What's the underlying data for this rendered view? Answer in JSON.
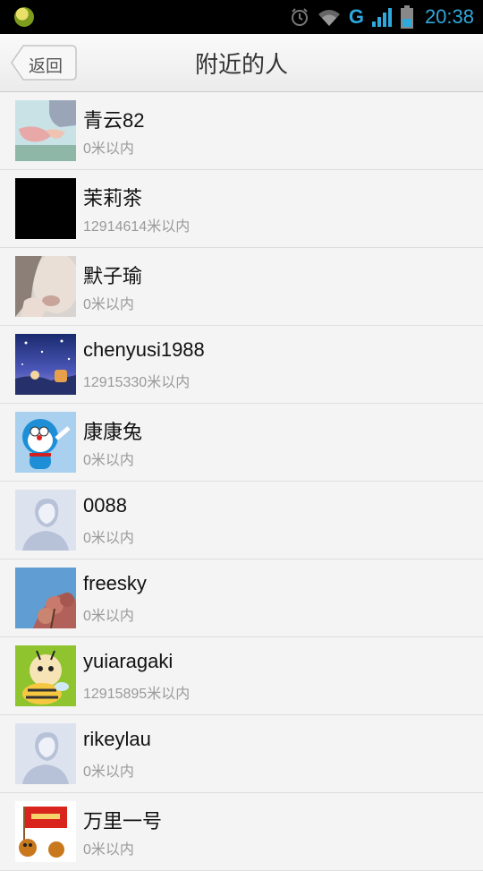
{
  "status_bar": {
    "network_type": "G",
    "time": "20:38",
    "colors": {
      "background": "#000000",
      "accent": "#2fa8dc"
    },
    "icons": [
      "app-notification-icon",
      "alarm-icon",
      "wifi-icon",
      "signal-icon",
      "battery-icon"
    ]
  },
  "header": {
    "back_label": "返回",
    "title": "附近的人"
  },
  "people": [
    {
      "name": "青云82",
      "distance": "0米以内",
      "avatar": "photo-hands"
    },
    {
      "name": "茉莉茶",
      "distance": "12914614米以内",
      "avatar": "black"
    },
    {
      "name": "默子瑜",
      "distance": "0米以内",
      "avatar": "photo-face"
    },
    {
      "name": "chenyusi1988",
      "distance": "12915330米以内",
      "avatar": "photo-night-sky"
    },
    {
      "name": "康康兔",
      "distance": "0米以内",
      "avatar": "doraemon"
    },
    {
      "name": "0088",
      "distance": "0米以内",
      "avatar": "default-person"
    },
    {
      "name": "freesky",
      "distance": "0米以内",
      "avatar": "photo-tree-sky"
    },
    {
      "name": "yuiaragaki",
      "distance": "12915895米以内",
      "avatar": "cartoon-bee"
    },
    {
      "name": "rikeylau",
      "distance": "0米以内",
      "avatar": "default-person"
    },
    {
      "name": "万里一号",
      "distance": "0米以内",
      "avatar": "cartoon-flag"
    }
  ]
}
